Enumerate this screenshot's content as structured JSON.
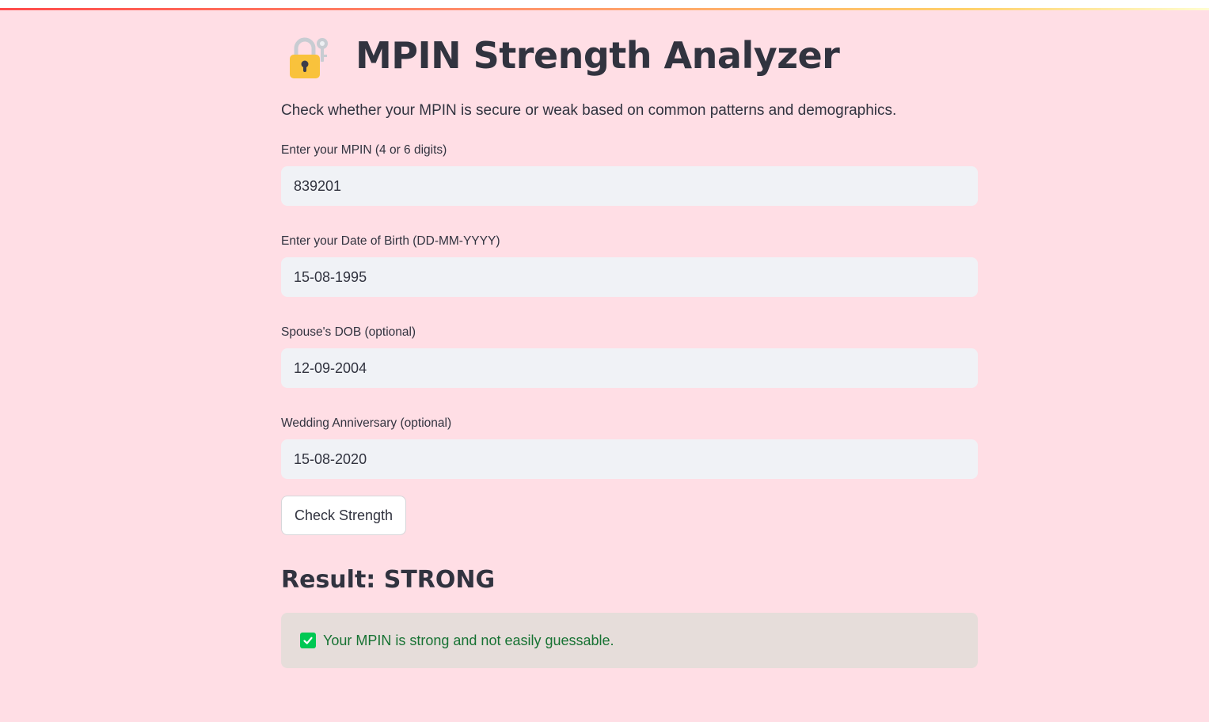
{
  "app": {
    "title": "MPIN Strength Analyzer",
    "subtitle": "Check whether your MPIN is secure or weak based on common patterns and demographics."
  },
  "fields": [
    {
      "label": "Enter your MPIN (4 or 6 digits)",
      "value": "839201"
    },
    {
      "label": "Enter your Date of Birth (DD-MM-YYYY)",
      "value": "15-08-1995"
    },
    {
      "label": "Spouse's DOB (optional)",
      "value": "12-09-2004"
    },
    {
      "label": "Wedding Anniversary (optional)",
      "value": "15-08-2020"
    }
  ],
  "button": {
    "label": "Check Strength"
  },
  "result": {
    "heading": "Result: STRONG",
    "message": "Your MPIN is strong and not easily guessable."
  },
  "icons": {
    "title_icon": "lock-with-key-icon",
    "result_icon": "check-mark-icon"
  },
  "colors": {
    "background": "#ffdee5",
    "input_bg": "#f0f2f6",
    "success_text": "#177233",
    "success_icon": "#00c853"
  }
}
